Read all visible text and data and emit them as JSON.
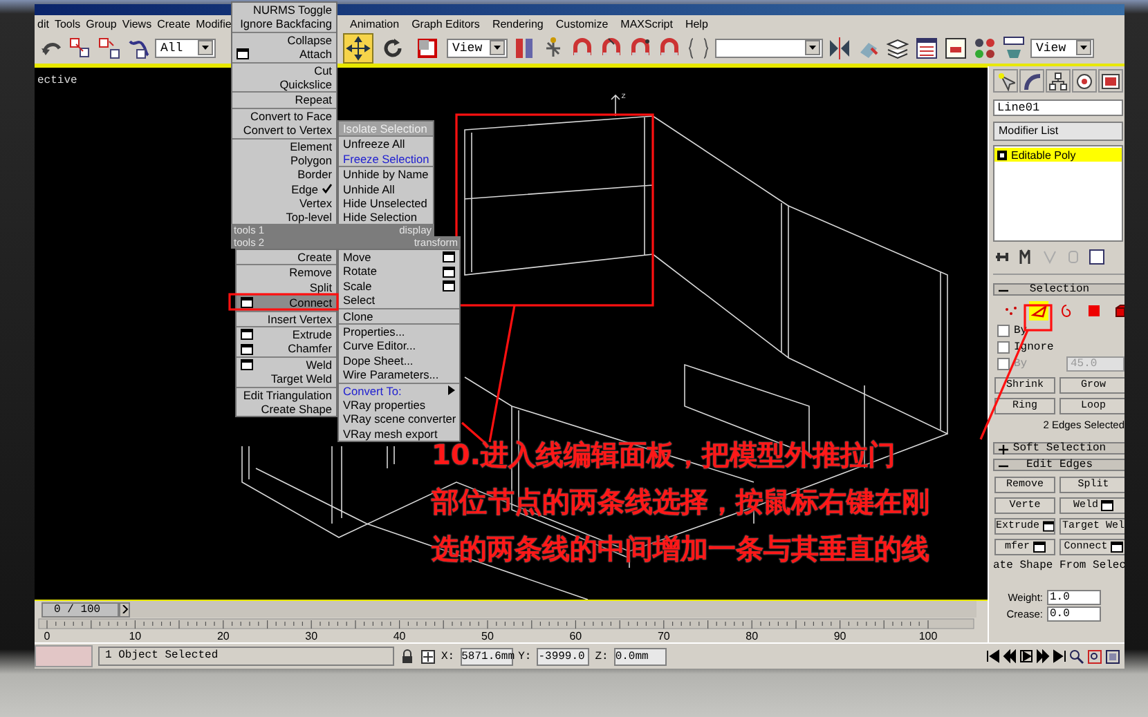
{
  "menu_bar": {
    "left": [
      "dit",
      "Tools",
      "Group",
      "Views",
      "Create",
      "Modifie"
    ],
    "right": [
      "Animation",
      "Graph Editors",
      "Rendering",
      "Customize",
      "MAXScript",
      "Help"
    ]
  },
  "toolbar": {
    "selection_filter": "All",
    "transform_tools": [
      {
        "selected": true
      },
      {
        "selected": false
      },
      {
        "selected": false
      }
    ],
    "coordinate_system": "View",
    "render_view": "View"
  },
  "viewport": {
    "label": "ective",
    "axis_label": "z"
  },
  "quad_menu": {
    "top_left": [
      {
        "items": [
          {
            "label": "NURMS Toggle",
            "options": false,
            "checked": false
          },
          {
            "label": "Ignore Backfacing",
            "options": false,
            "checked": false
          }
        ]
      },
      {
        "items": [
          {
            "label": "Collapse",
            "options": false,
            "checked": false
          },
          {
            "label": "Attach",
            "options": true,
            "checked": false
          }
        ]
      },
      {
        "items": [
          {
            "label": "Cut",
            "options": false,
            "checked": false
          },
          {
            "label": "Quickslice",
            "options": false,
            "checked": false
          }
        ]
      },
      {
        "items": [
          {
            "label": "Repeat",
            "options": false,
            "checked": false
          }
        ]
      },
      {
        "items": [
          {
            "label": "Convert to Face",
            "options": false,
            "checked": false
          },
          {
            "label": "Convert to Vertex",
            "options": false,
            "checked": false
          }
        ]
      },
      {
        "items": [
          {
            "label": "Element",
            "options": false,
            "checked": false
          },
          {
            "label": "Polygon",
            "options": false,
            "checked": false
          },
          {
            "label": "Border",
            "options": false,
            "checked": false
          },
          {
            "label": "Edge",
            "options": false,
            "checked": true
          },
          {
            "label": "Vertex",
            "options": false,
            "checked": false
          },
          {
            "label": "Top-level",
            "options": false,
            "checked": false
          }
        ]
      }
    ],
    "top_right": [
      {
        "items": [
          {
            "label": "Isolate Selection",
            "disabled": true,
            "highlighted": false
          }
        ]
      },
      {
        "items": [
          {
            "label": "Unfreeze All",
            "disabled": false,
            "highlighted": false
          },
          {
            "label": "Freeze Selection",
            "disabled": false,
            "highlighted": true
          }
        ]
      },
      {
        "items": [
          {
            "label": "Unhide by Name",
            "disabled": false,
            "highlighted": false
          },
          {
            "label": "Unhide All",
            "disabled": false,
            "highlighted": false
          },
          {
            "label": "Hide Unselected",
            "disabled": false,
            "highlighted": false
          },
          {
            "label": "Hide Selection",
            "disabled": false,
            "highlighted": false
          }
        ]
      }
    ],
    "headers": [
      {
        "left": "tools 1",
        "right": "display"
      },
      {
        "left": "tools 2",
        "right": "transform"
      }
    ],
    "bottom_left": [
      {
        "items": [
          {
            "label": "Create",
            "options": false,
            "selected": false
          }
        ]
      },
      {
        "items": [
          {
            "label": "Remove",
            "options": false,
            "selected": false
          },
          {
            "label": "Split",
            "options": false,
            "selected": false
          }
        ]
      },
      {
        "items": [
          {
            "label": "Connect",
            "options": true,
            "selected": true
          }
        ]
      },
      {
        "items": [
          {
            "label": "Insert Vertex",
            "options": false,
            "selected": false
          }
        ]
      },
      {
        "items": [
          {
            "label": "Extrude",
            "options": true,
            "selected": false
          },
          {
            "label": "Chamfer",
            "options": true,
            "selected": false
          }
        ]
      },
      {
        "items": [
          {
            "label": "Weld",
            "options": true,
            "selected": false
          },
          {
            "label": "Target Weld",
            "options": false,
            "selected": false
          }
        ]
      },
      {
        "items": [
          {
            "label": "Edit Triangulation",
            "options": false,
            "selected": false
          },
          {
            "label": "Create Shape",
            "options": false,
            "selected": false
          }
        ]
      }
    ],
    "bottom_right": [
      {
        "items": [
          {
            "label": "Move",
            "options": true,
            "highlighted": false,
            "submenu": false
          },
          {
            "label": "Rotate",
            "options": true,
            "highlighted": false,
            "submenu": false
          },
          {
            "label": "Scale",
            "options": true,
            "highlighted": false,
            "submenu": false
          },
          {
            "label": "Select",
            "options": false,
            "highlighted": false,
            "submenu": false
          }
        ]
      },
      {
        "items": [
          {
            "label": "Clone",
            "options": false,
            "highlighted": false,
            "submenu": false
          }
        ]
      },
      {
        "items": [
          {
            "label": "Properties...",
            "options": false,
            "highlighted": false,
            "submenu": false
          },
          {
            "label": "Curve Editor...",
            "options": false,
            "highlighted": false,
            "submenu": false
          },
          {
            "label": "Dope Sheet...",
            "options": false,
            "highlighted": false,
            "submenu": false
          },
          {
            "label": "Wire Parameters...",
            "options": false,
            "highlighted": false,
            "submenu": false
          }
        ]
      },
      {
        "items": [
          {
            "label": "Convert To:",
            "options": false,
            "highlighted": true,
            "submenu": true
          },
          {
            "label": "VRay properties",
            "options": false,
            "highlighted": false,
            "submenu": false
          },
          {
            "label": "VRay scene converter",
            "options": false,
            "highlighted": false,
            "submenu": false
          },
          {
            "label": "VRay mesh export",
            "options": false,
            "highlighted": false,
            "submenu": false
          }
        ]
      }
    ]
  },
  "annotation": {
    "lines": [
      "10.进入线编辑面板，把模型外推拉门",
      "部位节点的两条线选择，按鼠标右键在刚",
      "选的两条线的中间增加一条与其垂直的线"
    ]
  },
  "command_panel": {
    "object_name": "Line01",
    "modifier_list": "Modifier List",
    "stack": [
      {
        "label": "Editable Poly",
        "selected": true
      }
    ],
    "selection_rollout": {
      "title": "Selection",
      "expanded": true,
      "subobjects": [
        {
          "selected": false
        },
        {
          "selected": true
        },
        {
          "selected": false
        },
        {
          "selected": false
        },
        {
          "selected": false
        }
      ],
      "checkboxes": [
        {
          "label": "By",
          "checked": false,
          "disabled": false
        },
        {
          "label": "Ignore",
          "checked": false,
          "disabled": false
        },
        {
          "label": "By",
          "checked": false,
          "disabled": true
        }
      ],
      "angle": "45.0",
      "buttons": [
        "Shrink",
        "Grow",
        "Ring",
        "Loop"
      ],
      "info": "2 Edges Selected"
    },
    "rollouts": [
      {
        "title": "Soft Selection",
        "expanded": false
      },
      {
        "title": "Edit Edges",
        "expanded": true
      }
    ],
    "edit_edges_buttons": [
      {
        "label": "Remove",
        "options": false
      },
      {
        "label": "Split",
        "options": false
      },
      {
        "label": "Verte",
        "options": false
      },
      {
        "label": "Weld",
        "options": true
      },
      {
        "label": "Extrude",
        "options": true
      },
      {
        "label": "Target Wel",
        "options": false
      },
      {
        "label": "mfer",
        "options": true
      },
      {
        "label": "Connect",
        "options": true
      }
    ],
    "create_shape": "ate Shape From Selec",
    "spinners": [
      {
        "label": "Weight:",
        "value": "1.0"
      },
      {
        "label": "Crease:",
        "value": "0.0"
      }
    ]
  },
  "timeline": {
    "position": "0 / 100",
    "level": 0,
    "frame_labels": [
      "0",
      "10",
      "20",
      "30",
      "40",
      "50",
      "60",
      "70",
      "80",
      "90",
      "100"
    ]
  },
  "status_bar": {
    "message": "1 Object Selected",
    "coords": [
      {
        "label": "X:",
        "value": "5871.6mm"
      },
      {
        "label": "Y:",
        "value": "-3999.0"
      },
      {
        "label": "Z:",
        "value": "0.0mm"
      }
    ]
  }
}
